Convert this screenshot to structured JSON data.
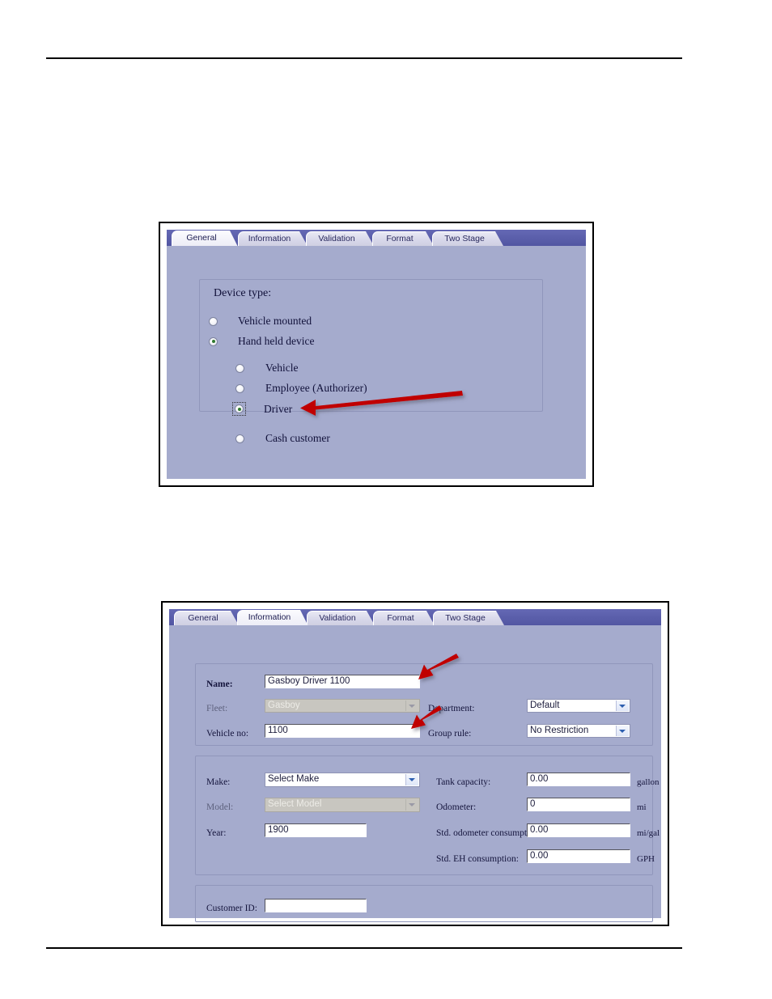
{
  "figure_one": {
    "name": "device-type-general-tab-dialog",
    "tabs": [
      {
        "label": "General",
        "active": true
      },
      {
        "label": "Information",
        "active": false
      },
      {
        "label": "Validation",
        "active": false
      },
      {
        "label": "Format",
        "active": false
      },
      {
        "label": "Two Stage",
        "active": false
      }
    ],
    "group_legend": "Device type:",
    "options": [
      {
        "label": "Vehicle mounted",
        "checked": false,
        "level": 1,
        "focused": false
      },
      {
        "label": "Hand held device",
        "checked": true,
        "level": 1,
        "focused": false
      },
      {
        "label": "Vehicle",
        "checked": false,
        "level": 2,
        "focused": false
      },
      {
        "label": "Employee (Authorizer)",
        "checked": false,
        "level": 2,
        "focused": false
      },
      {
        "label": "Driver",
        "checked": true,
        "level": 2,
        "focused": true
      },
      {
        "label": "Cash customer",
        "checked": false,
        "level": 2,
        "focused": false
      }
    ]
  },
  "figure_two": {
    "name": "information-tab-dialog",
    "tabs": [
      {
        "label": "General",
        "active": false
      },
      {
        "label": "Information",
        "active": true
      },
      {
        "label": "Validation",
        "active": false
      },
      {
        "label": "Format",
        "active": false
      },
      {
        "label": "Two Stage",
        "active": false
      }
    ],
    "identity_fields": {
      "name_label": "Name:",
      "name_value": "Gasboy Driver 1100",
      "fleet_label": "Fleet:",
      "fleet_value": "Gasboy",
      "vehicle_no_label": "Vehicle no:",
      "vehicle_no_value": "1100",
      "department_label": "Department:",
      "department_value": "Default",
      "group_rule_label": "Group rule:",
      "group_rule_value": "No Restriction"
    },
    "vehicle_fields": {
      "make_label": "Make:",
      "make_value": "Select Make",
      "model_label": "Model:",
      "model_value": "Select Model",
      "year_label": "Year:",
      "year_value": "1900",
      "tank_capacity_label": "Tank capacity:",
      "tank_capacity_value": "0.00",
      "tank_capacity_unit": "gallon",
      "odometer_label": "Odometer:",
      "odometer_value": "0",
      "odometer_unit": "mi",
      "std_odometer_label": "Std. odometer consumption:",
      "std_odometer_value": "0.00",
      "std_odometer_unit": "mi/gal",
      "std_eh_label": "Std. EH consumption:",
      "std_eh_value": "0.00",
      "std_eh_unit": "GPH"
    },
    "customer_fields": {
      "customer_id_label": "Customer ID:",
      "customer_id_value": ""
    }
  },
  "annotations": {
    "arrow_color": "#c00000",
    "arrow_driver": "callout-arrow-driver-radio",
    "arrow_name": "callout-arrow-name-field",
    "arrow_vehicle_no": "callout-arrow-vehicle-no-field"
  }
}
